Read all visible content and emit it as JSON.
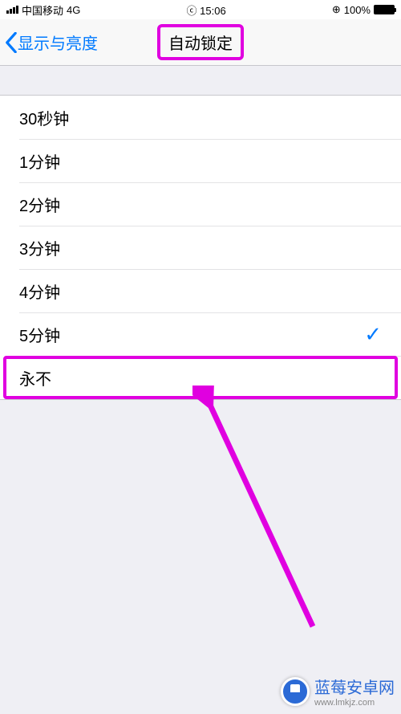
{
  "status_bar": {
    "carrier": "中国移动",
    "network": "4G",
    "time": "15:06",
    "battery_pct": "100%",
    "lock_icon": "⊕"
  },
  "nav": {
    "back_label": "显示与亮度",
    "title": "自动锁定"
  },
  "options": [
    {
      "label": "30秒钟",
      "selected": false,
      "highlight": false
    },
    {
      "label": "1分钟",
      "selected": false,
      "highlight": false
    },
    {
      "label": "2分钟",
      "selected": false,
      "highlight": false
    },
    {
      "label": "3分钟",
      "selected": false,
      "highlight": false
    },
    {
      "label": "4分钟",
      "selected": false,
      "highlight": false
    },
    {
      "label": "5分钟",
      "selected": true,
      "highlight": false
    },
    {
      "label": "永不",
      "selected": false,
      "highlight": true
    }
  ],
  "annotation": {
    "highlight_color": "#e000e0"
  },
  "watermark": {
    "text": "蓝莓安卓网",
    "url": "www.lmkjz.com"
  }
}
